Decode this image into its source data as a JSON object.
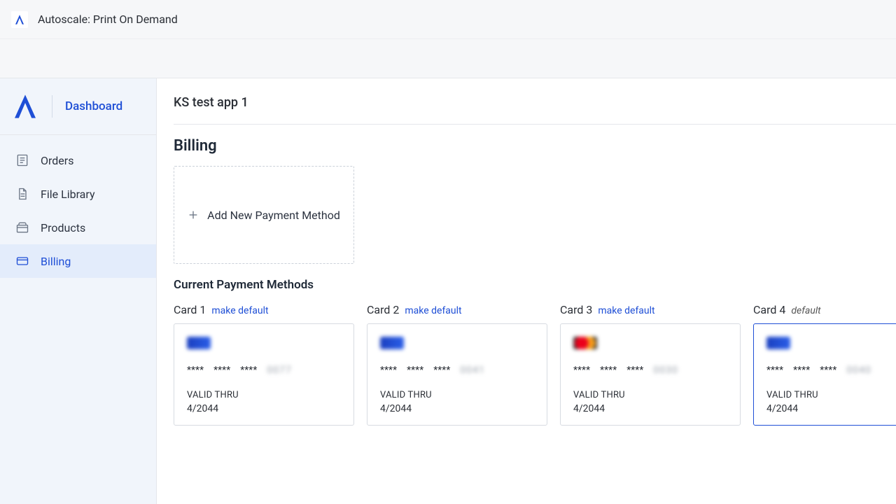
{
  "topbar": {
    "title": "Autoscale: Print On Demand"
  },
  "sidebar": {
    "dashboard_label": "Dashboard",
    "items": [
      {
        "label": "Orders"
      },
      {
        "label": "File Library"
      },
      {
        "label": "Products"
      },
      {
        "label": "Billing"
      }
    ]
  },
  "main": {
    "app_name": "KS test app 1",
    "section_title": "Billing",
    "add_payment_label": "Add New Payment Method",
    "subsection_title": "Current Payment Methods",
    "make_default_label": "make default",
    "default_label": "default",
    "valid_thru_label": "VALID THRU",
    "masked_group": "****",
    "cards": [
      {
        "name": "Card 1",
        "brand": "visa",
        "last4": "0077",
        "valid": "4/2044",
        "is_default": false
      },
      {
        "name": "Card 2",
        "brand": "visa",
        "last4": "0041",
        "valid": "4/2044",
        "is_default": false
      },
      {
        "name": "Card 3",
        "brand": "mc",
        "last4": "0030",
        "valid": "4/2044",
        "is_default": false
      },
      {
        "name": "Card 4",
        "brand": "visa",
        "last4": "0040",
        "valid": "4/2044",
        "is_default": true
      }
    ]
  }
}
